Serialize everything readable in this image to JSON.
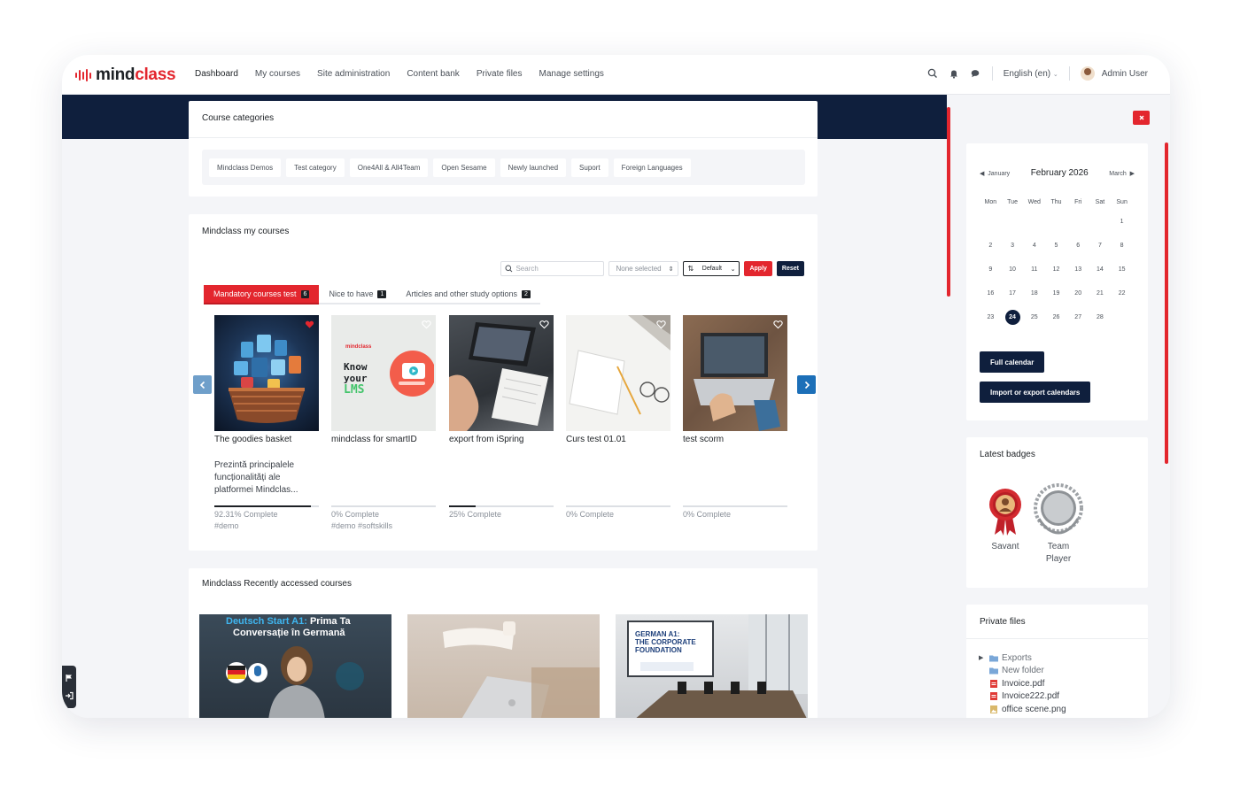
{
  "brand": {
    "name_part1": "mind",
    "name_part2": "class"
  },
  "nav": {
    "items": [
      "Dashboard",
      "My courses",
      "Site administration",
      "Content bank",
      "Private files",
      "Manage settings"
    ],
    "language": "English (en)",
    "user": "Admin User"
  },
  "categories": {
    "title": "Course categories",
    "items": [
      "Mindclass Demos",
      "Test category",
      "One4All & All4Team",
      "Open Sesame",
      "Newly launched",
      "Suport",
      "Foreign Languages"
    ]
  },
  "my_courses": {
    "title": "Mindclass my courses",
    "search_placeholder": "Search",
    "filter_value": "None selected",
    "sort_value": "Default",
    "apply_label": "Apply",
    "reset_label": "Reset",
    "tabs": [
      {
        "label": "Mandatory courses test",
        "count": "6",
        "active": true
      },
      {
        "label": "Nice to have",
        "count": "1",
        "active": false
      },
      {
        "label": "Articles and other study options",
        "count": "2",
        "active": false
      }
    ],
    "courses": [
      {
        "name": "The goodies basket",
        "description": "Prezintă principalele funcționalități ale platformei Mindclas...",
        "progress": 92.31,
        "progress_label": "92.31% Complete",
        "tags": "#demo",
        "favorite": true
      },
      {
        "name": "mindclass for smartID",
        "description": "",
        "progress": 0,
        "progress_label": "0% Complete",
        "tags": "#demo #softskills",
        "favorite": false
      },
      {
        "name": "export from iSpring",
        "description": "",
        "progress": 25,
        "progress_label": "25% Complete",
        "tags": "",
        "favorite": false
      },
      {
        "name": "Curs test 01.01",
        "description": "",
        "progress": 0,
        "progress_label": "0% Complete",
        "tags": "",
        "favorite": false
      },
      {
        "name": "test scorm",
        "description": "",
        "progress": 0,
        "progress_label": "0% Complete",
        "tags": "",
        "favorite": false
      }
    ],
    "thumb_text": {
      "brand": "mindclass",
      "line1": "Know",
      "line2": "your",
      "line3": "LMS"
    }
  },
  "recent": {
    "title": "Mindclass Recently accessed courses",
    "thumb1": {
      "line1a": "Deutsch Start A1:",
      "line1b": " Prima Ta",
      "line2": "Conversație în Germană"
    },
    "thumb3": {
      "line1": "GERMAN A1:",
      "line2": "THE CORPORATE",
      "line3": "FOUNDATION"
    }
  },
  "calendar": {
    "prev": "January",
    "current": "February 2026",
    "next": "March",
    "weekdays": [
      "Mon",
      "Tue",
      "Wed",
      "Thu",
      "Fri",
      "Sat",
      "Sun"
    ],
    "leading_blanks": 6,
    "days": 28,
    "today": 24,
    "full_calendar_label": "Full calendar",
    "import_export_label": "Import or export calendars"
  },
  "badges": {
    "title": "Latest badges",
    "items": [
      "Savant",
      "Team Player"
    ]
  },
  "private_files": {
    "title": "Private files",
    "items": [
      {
        "name": "Exports",
        "type": "folder"
      },
      {
        "name": "New folder",
        "type": "folder"
      },
      {
        "name": "Invoice.pdf",
        "type": "pdf"
      },
      {
        "name": "Invoice222.pdf",
        "type": "pdf"
      },
      {
        "name": "office scene.png",
        "type": "image"
      }
    ]
  },
  "colors": {
    "accent": "#e3262e",
    "navy": "#0f1f3d",
    "arrow_blue": "#1c6fb8"
  }
}
